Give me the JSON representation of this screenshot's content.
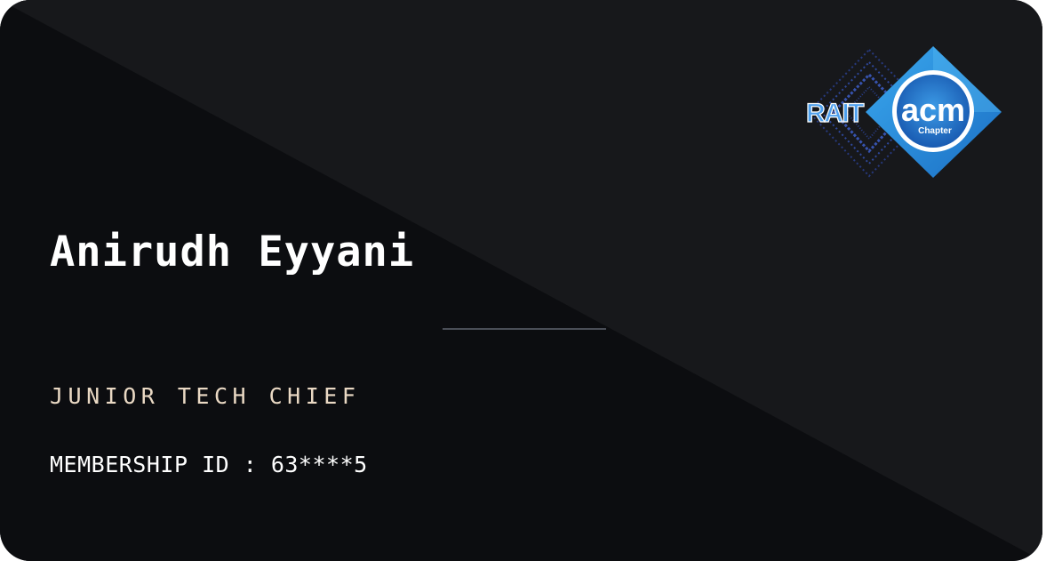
{
  "card": {
    "name": "Anirudh Eyyani",
    "role": "JUNIOR TECH CHIEF",
    "membership_label": "MEMBERSHIP ID",
    "membership_separator": " : ",
    "membership_id": "63****5"
  },
  "logo": {
    "icon": "rait-acm-chapter-logo-icon",
    "text_rait": "RAIT",
    "text_acm": "acm",
    "text_chapter": "Chapter"
  },
  "colors": {
    "card_background_dark": "#0c0d10",
    "card_background_light": "#17181b",
    "name_text": "#ffffff",
    "role_text": "#ead9c4",
    "divider": "#4a4e57",
    "logo_blue": "#2a8fe0",
    "logo_dark_blue": "#1e5fb8"
  }
}
